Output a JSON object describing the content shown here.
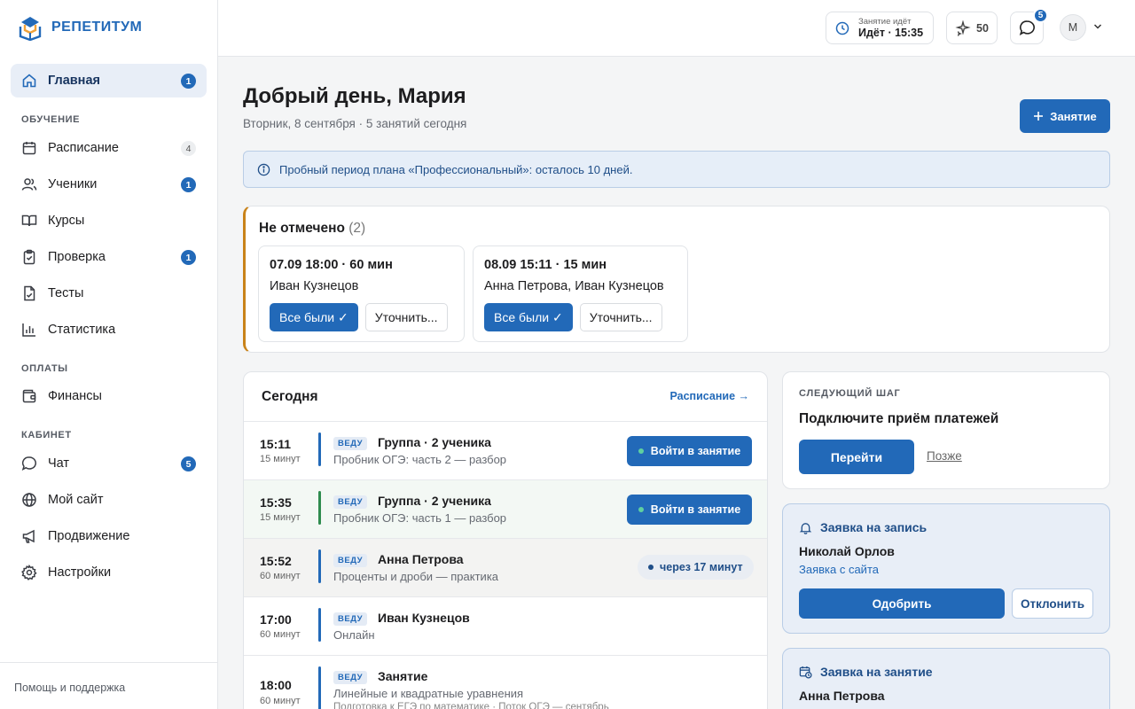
{
  "brand": {
    "name": "РЕПЕТИТУМ"
  },
  "sidebar": {
    "items": [
      {
        "label": "Главная",
        "badge": "1",
        "icon": "home-icon"
      },
      {
        "label": "Расписание",
        "badge": "4",
        "icon": "calendar-icon"
      },
      {
        "label": "Ученики",
        "badge": "1",
        "icon": "users-icon"
      },
      {
        "label": "Курсы",
        "badge": "",
        "icon": "book-icon"
      },
      {
        "label": "Проверка",
        "badge": "1",
        "icon": "clipboard-icon"
      },
      {
        "label": "Тесты",
        "badge": "",
        "icon": "test-file-icon"
      },
      {
        "label": "Статистика",
        "badge": "",
        "icon": "chart-icon"
      },
      {
        "label": "Финансы",
        "badge": "",
        "icon": "wallet-icon"
      },
      {
        "label": "Чат",
        "badge": "5",
        "icon": "chat-icon"
      },
      {
        "label": "Мой сайт",
        "badge": "",
        "icon": "globe-icon"
      },
      {
        "label": "Продвижение",
        "badge": "",
        "icon": "megaphone-icon"
      },
      {
        "label": "Настройки",
        "badge": "",
        "icon": "gear-icon"
      }
    ],
    "sections": {
      "learning": "ОБУЧЕНИЕ",
      "payments": "ОПЛАТЫ",
      "cabinet": "КАБИНЕТ"
    },
    "help": "Помощь и поддержка"
  },
  "topbar": {
    "lesson_status_small": "Занятие идёт",
    "lesson_status_big": "Идёт · 15:35",
    "points": "50",
    "chat_badge": "5",
    "avatar_letter": "М"
  },
  "header": {
    "greeting": "Добрый день, Мария",
    "subtitle": "Вторник, 8 сентября · 5 занятий сегодня",
    "add_button": "Занятие"
  },
  "notice": {
    "text": "Пробный период плана «Профессиональный»: осталось 10 дней."
  },
  "unmarked": {
    "title": "Не отмечено",
    "count": "(2)",
    "items": [
      {
        "time": "07.09 18:00 · 60 мин",
        "who": "Иван Кузнецов",
        "primary": "Все были ✓",
        "secondary": "Уточнить..."
      },
      {
        "time": "08.09 15:11 · 15 мин",
        "who": "Анна Петрова, Иван Кузнецов",
        "primary": "Все были ✓",
        "secondary": "Уточнить..."
      }
    ]
  },
  "today": {
    "title": "Сегодня",
    "link": "Расписание →",
    "tag": "ВЕДУ",
    "rows": [
      {
        "time": "15:11",
        "duration": "15 минут",
        "title": "Группа · 2 ученика",
        "sub": "Пробник ОГЭ: часть 2 — разбор",
        "action": "Войти в занятие"
      },
      {
        "time": "15:35",
        "duration": "15 минут",
        "title": "Группа · 2 ученика",
        "sub": "Пробник ОГЭ: часть 1 — разбор",
        "action": "Войти в занятие"
      },
      {
        "time": "15:52",
        "duration": "60 минут",
        "title": "Анна Петрова",
        "sub": "Проценты и дроби — практика",
        "action": "через 17 минут"
      },
      {
        "time": "17:00",
        "duration": "60 минут",
        "title": "Иван Кузнецов",
        "sub": "Онлайн",
        "action": ""
      },
      {
        "time": "18:00",
        "duration": "60 минут",
        "title": "Занятие",
        "sub": "Линейные и квадратные уравнения",
        "sub2": "Подготовка к ЕГЭ по математике · Поток ОГЭ — сентябрь",
        "action": ""
      }
    ]
  },
  "next_step": {
    "label": "СЛЕДУЮЩИЙ ШАГ",
    "title": "Подключите приём платежей",
    "go": "Перейти",
    "later": "Позже"
  },
  "request_signup": {
    "title": "Заявка на запись",
    "name": "Николай Орлов",
    "source": "Заявка с сайта",
    "approve": "Одобрить",
    "decline": "Отклонить"
  },
  "request_lesson": {
    "title": "Заявка на занятие",
    "name": "Анна Петрова"
  },
  "colors": {
    "accent": "#2269b8",
    "warning_border": "#c9831a",
    "live_green": "#2f8c4f"
  }
}
